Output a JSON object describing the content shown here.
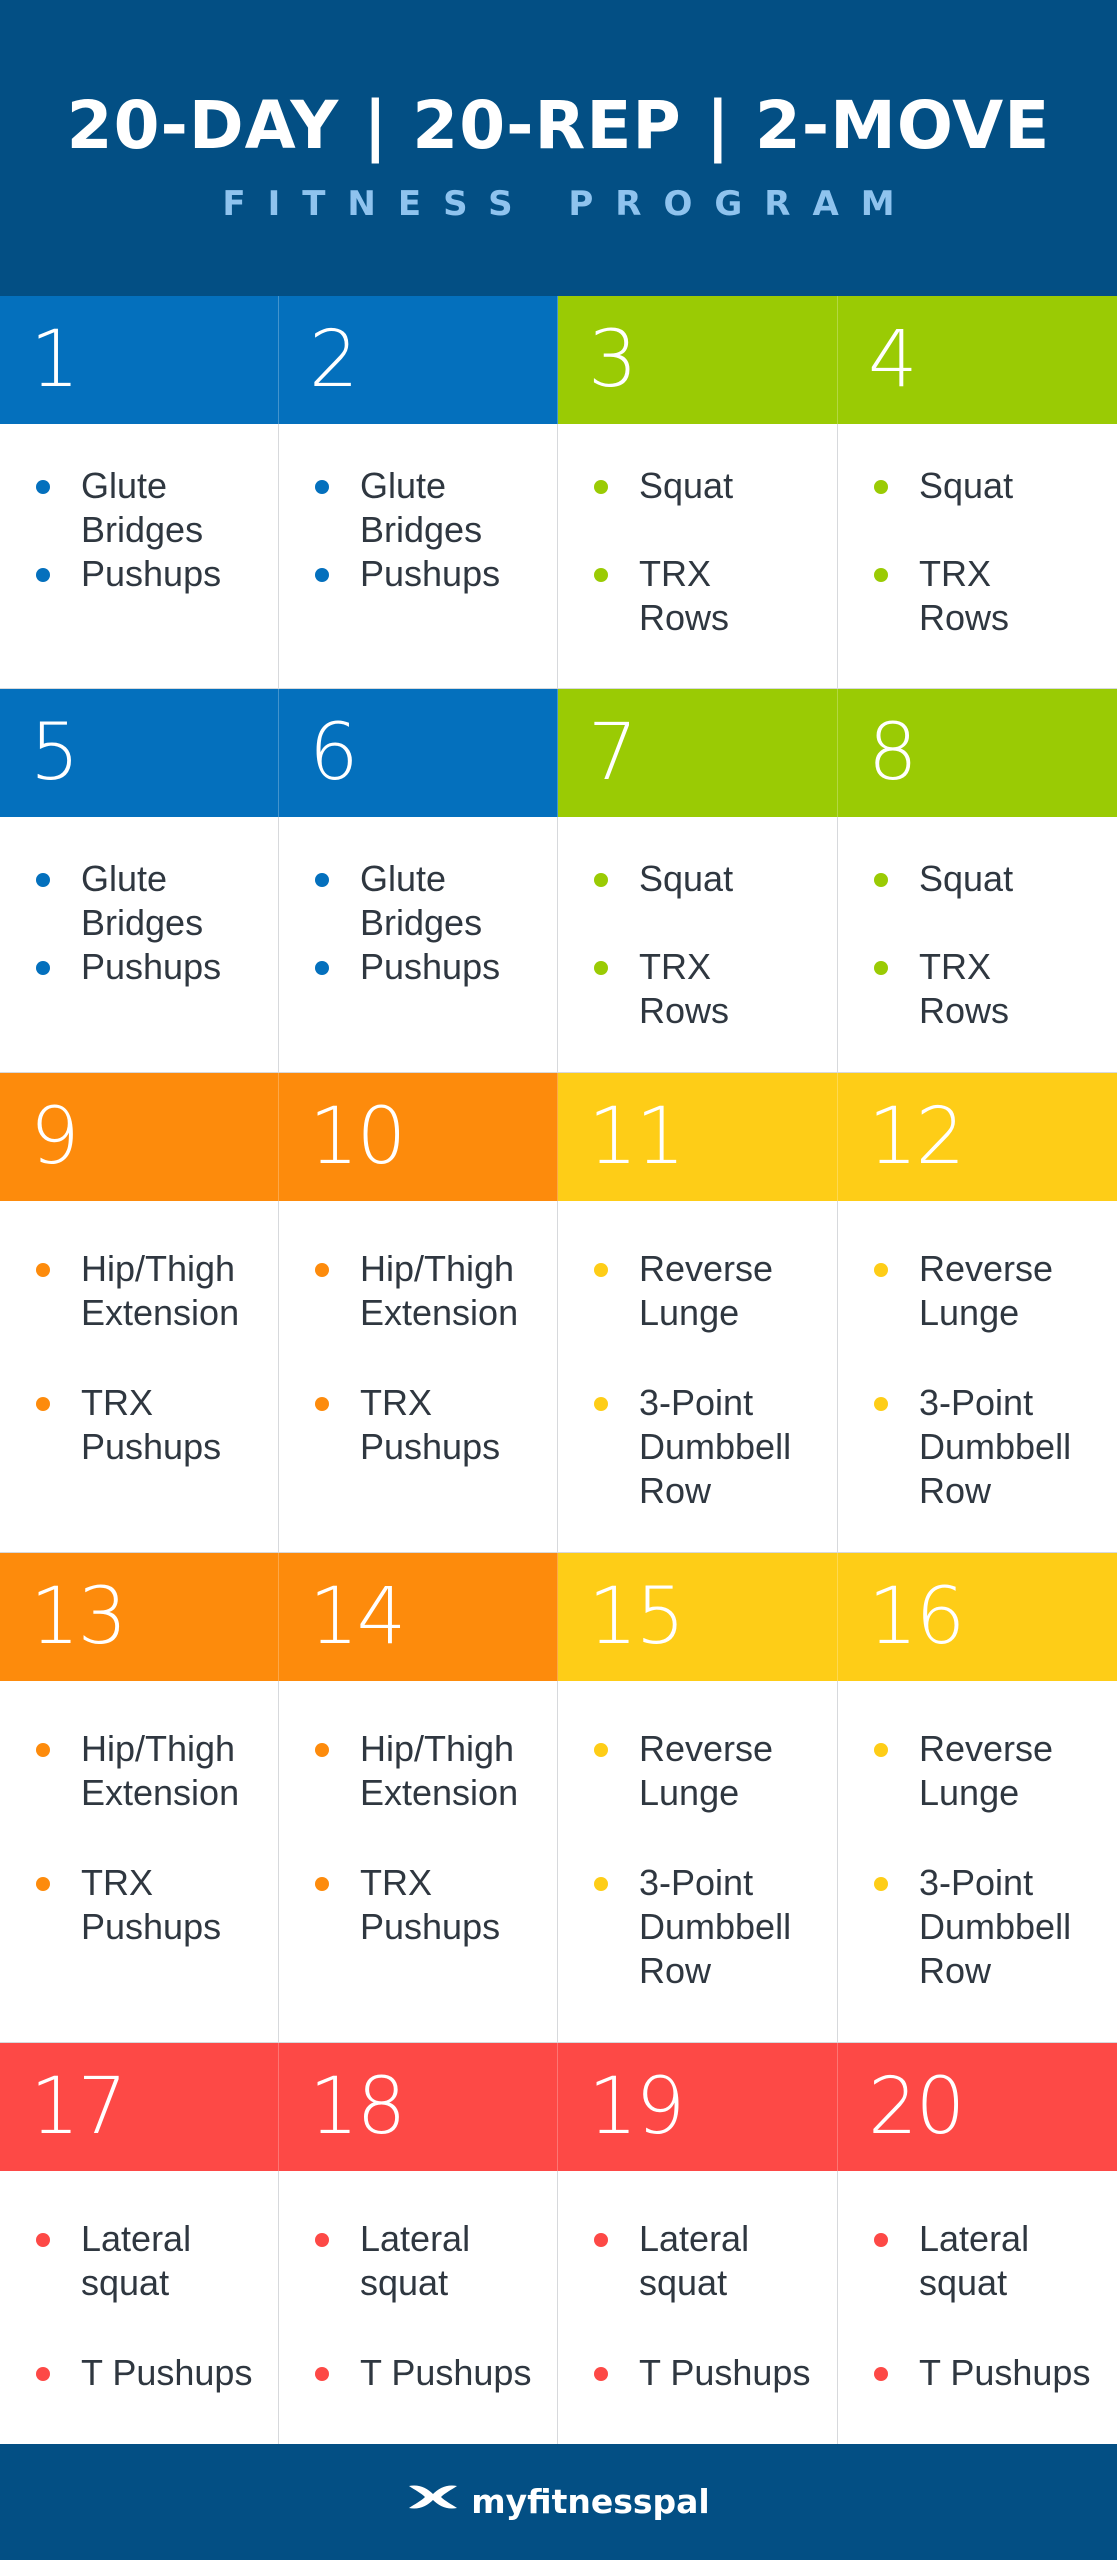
{
  "header": {
    "title": "20-DAY | 20-REP | 2-MOVE",
    "subtitle": "FITNESS PROGRAM"
  },
  "colors": {
    "navy": "#034f84",
    "blue": "#0470bd",
    "green": "#9acb04",
    "orange": "#fd8b0c",
    "yellow": "#fecd17",
    "red": "#fd4946"
  },
  "days": [
    {
      "day": "1",
      "color": "blue",
      "moves": [
        "Glute\nBridges",
        "Pushups"
      ]
    },
    {
      "day": "2",
      "color": "blue",
      "moves": [
        "Glute\nBridges",
        "Pushups"
      ]
    },
    {
      "day": "3",
      "color": "green",
      "moves": [
        "Squat",
        "TRX\nRows"
      ]
    },
    {
      "day": "4",
      "color": "green",
      "moves": [
        "Squat",
        "TRX\nRows"
      ]
    },
    {
      "day": "5",
      "color": "blue",
      "moves": [
        "Glute\nBridges",
        "Pushups"
      ]
    },
    {
      "day": "6",
      "color": "blue",
      "moves": [
        "Glute\nBridges",
        "Pushups"
      ]
    },
    {
      "day": "7",
      "color": "green",
      "moves": [
        "Squat",
        "TRX\nRows"
      ]
    },
    {
      "day": "8",
      "color": "green",
      "moves": [
        "Squat",
        "TRX\nRows"
      ]
    },
    {
      "day": "9",
      "color": "orange",
      "moves": [
        "Hip/Thigh\nExtension",
        "TRX\nPushups"
      ]
    },
    {
      "day": "10",
      "color": "orange",
      "moves": [
        "Hip/Thigh\nExtension",
        "TRX\nPushups"
      ]
    },
    {
      "day": "11",
      "color": "yellow",
      "moves": [
        "Reverse\nLunge",
        "3-Point\nDumbbell\nRow"
      ]
    },
    {
      "day": "12",
      "color": "yellow",
      "moves": [
        "Reverse\nLunge",
        "3-Point\nDumbbell\nRow"
      ]
    },
    {
      "day": "13",
      "color": "orange",
      "moves": [
        "Hip/Thigh\nExtension",
        "TRX\nPushups"
      ]
    },
    {
      "day": "14",
      "color": "orange",
      "moves": [
        "Hip/Thigh\nExtension",
        "TRX\nPushups"
      ]
    },
    {
      "day": "15",
      "color": "yellow",
      "moves": [
        "Reverse\nLunge",
        "3-Point\nDumbbell\nRow"
      ]
    },
    {
      "day": "16",
      "color": "yellow",
      "moves": [
        "Reverse\nLunge",
        "3-Point\nDumbbell\nRow"
      ]
    },
    {
      "day": "17",
      "color": "red",
      "moves": [
        "Lateral\nsquat",
        "T Pushups"
      ]
    },
    {
      "day": "18",
      "color": "red",
      "moves": [
        "Lateral\nsquat",
        "T Pushups"
      ]
    },
    {
      "day": "19",
      "color": "red",
      "moves": [
        "Lateral\nsquat",
        "T Pushups"
      ]
    },
    {
      "day": "20",
      "color": "red",
      "moves": [
        "Lateral\nsquat",
        "T Pushups"
      ]
    }
  ],
  "footer": {
    "brand": "myfitnesspal",
    "logo_icon": "under-armour-logo-icon"
  }
}
